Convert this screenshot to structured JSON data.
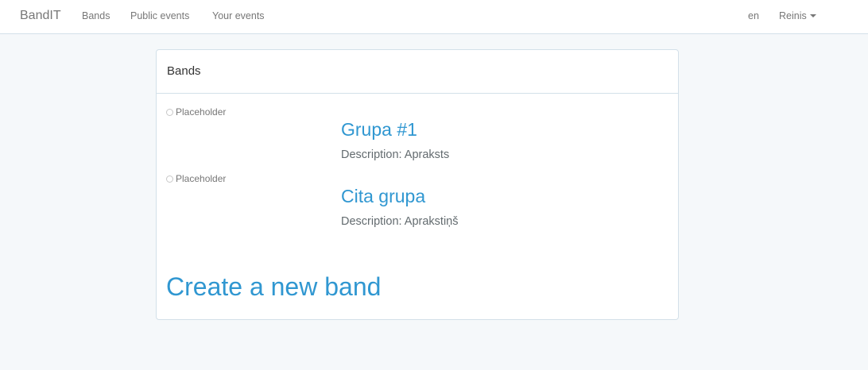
{
  "nav": {
    "brand": "BandIT",
    "links": [
      "Bands",
      "Public events",
      "Your events"
    ],
    "language": "en",
    "user": "Reinis"
  },
  "panel": {
    "title": "Bands",
    "bands": [
      {
        "image_alt": "Placeholder",
        "name": "Grupa #1",
        "description": "Description: Apraksts"
      },
      {
        "image_alt": "Placeholder",
        "name": "Cita grupa",
        "description": "Description: Aprakstiņš"
      }
    ],
    "create_label": "Create a new band"
  }
}
